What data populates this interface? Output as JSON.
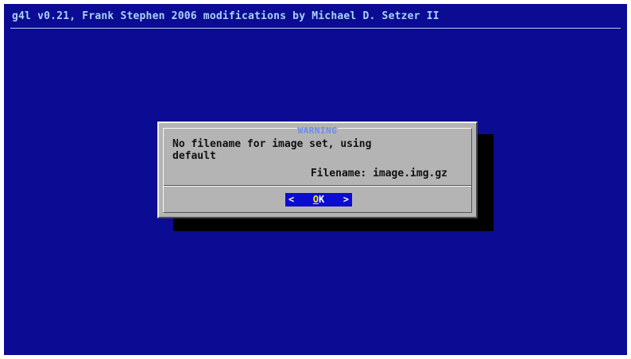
{
  "backtitle": "g4l v0.21, Frank Stephen 2006 modifications by Michael D. Setzer II",
  "dialog": {
    "title": "WARNING",
    "message_line1": "No filename for image set, using",
    "message_line2": "default",
    "filename_line": "Filename: image.img.gz",
    "ok_button": {
      "left_bracket": "<",
      "hotkey": "O",
      "rest": "K",
      "right_bracket": ">"
    }
  },
  "colors": {
    "screen_background": "#0b0b94",
    "dialog_background": "#b4b4b4",
    "title_text": "#6f8cf0",
    "button_background": "#0b0bd1",
    "hotkey": "#ffea00"
  }
}
